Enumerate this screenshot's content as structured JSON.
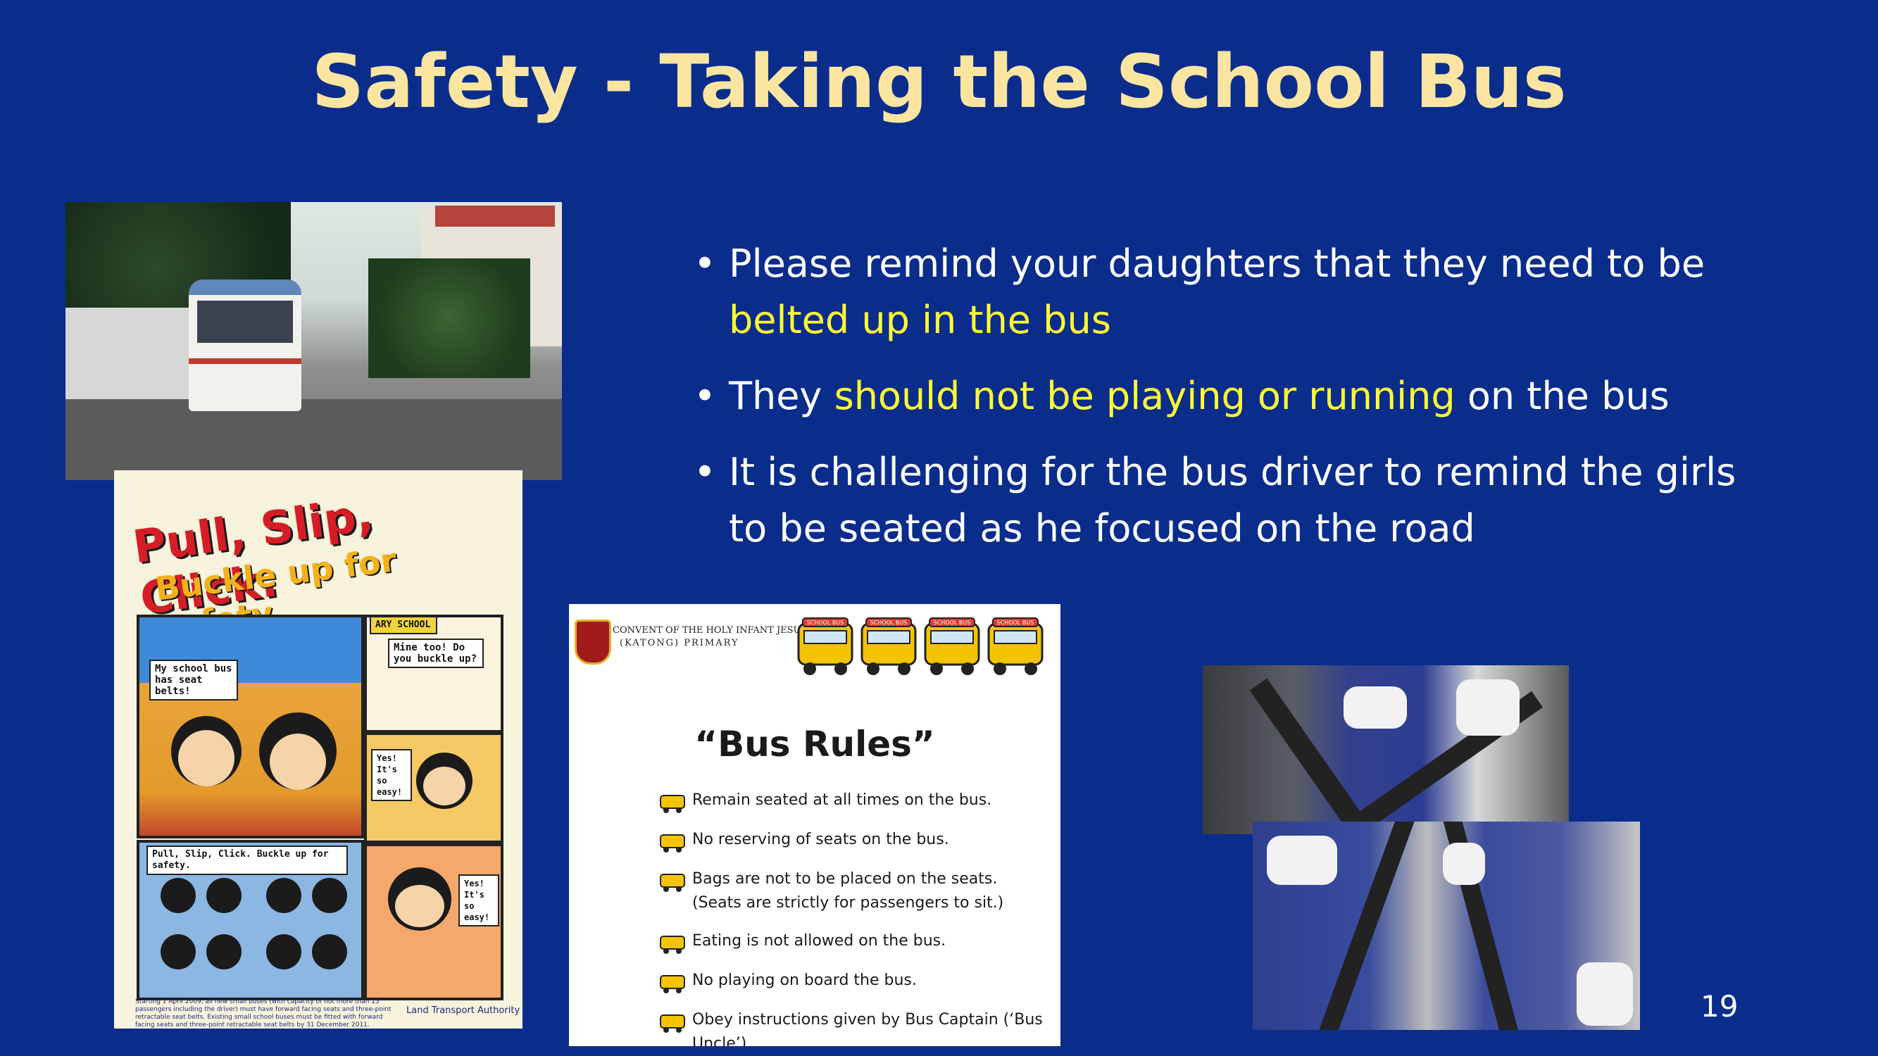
{
  "slide": {
    "title": "Safety - Taking the School Bus",
    "page_number": "19"
  },
  "bullets": [
    {
      "before": "Please remind your daughters that they need to be ",
      "highlight": "belted up in the bus",
      "after": ""
    },
    {
      "before": "They ",
      "highlight": "should not be playing or running",
      "after": " on the bus"
    },
    {
      "before": "It is challenging for the bus driver to remind the girls to be seated as he focused on the road",
      "highlight": "",
      "after": ""
    }
  ],
  "poster": {
    "headline1": "Pull, Slip, Click.",
    "headline2": "Buckle up for safety.",
    "school_sign": "ARY SCHOOL",
    "bubble1": "My school bus has seat belts!",
    "bubble2": "Mine too! Do you buckle up?",
    "bubble3": "Yes! It's so easy!",
    "bubble4": "Yes! It's so easy!",
    "caption": "Pull, Slip, Click. Buckle up for safety.",
    "footnote": "Starting 1 April 2009, all new small buses (with capacity of not more than 15 passengers including the driver) must have forward facing seats and three-point retractable seat belts. Existing small school buses must be fitted with forward facing seats and three-point retractable seat belts by 31 December 2011.",
    "authority": "Land Transport Authority"
  },
  "rules_card": {
    "school_line1": "CONVENT OF THE HOLY INFANT JESUS",
    "school_line2": "(KATONG) PRIMARY",
    "bus_label": "SCHOOL BUS",
    "heading": "“Bus Rules”",
    "items": [
      "Remain seated at all times on the bus.",
      "No reserving of seats on the bus.",
      "Bags are not to be placed on the seats.",
      "(Seats are strictly for passengers to sit.)",
      "Eating is not allowed on the bus.",
      "No playing on board the bus.",
      "Obey instructions given by Bus Captain (‘Bus Uncle’)"
    ]
  },
  "colors": {
    "background": "#0a2d8c",
    "title": "#fbe5a0",
    "highlight": "#ffff33",
    "text": "#ffffff"
  }
}
